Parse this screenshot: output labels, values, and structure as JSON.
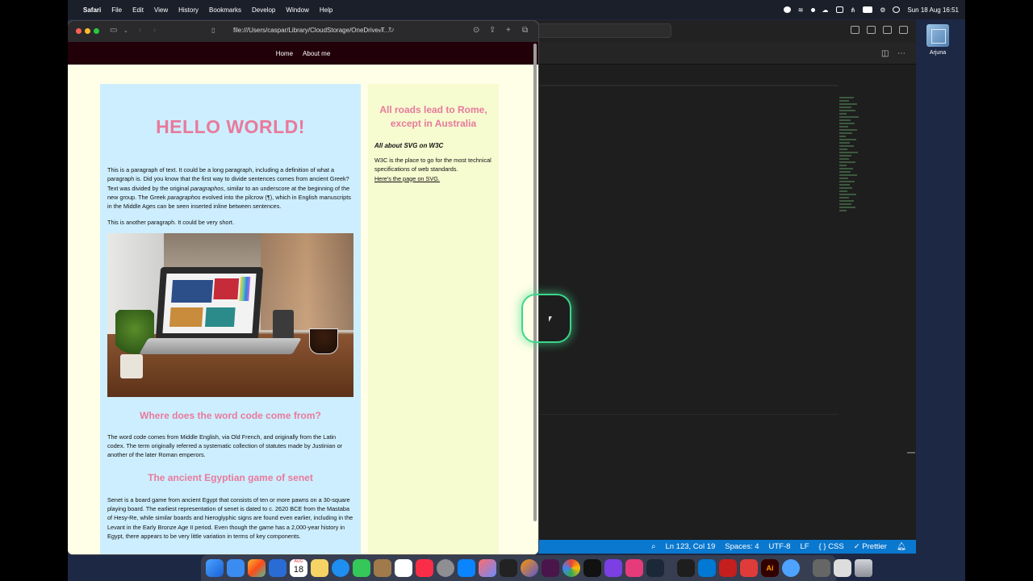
{
  "menubar": {
    "app_name": "Safari",
    "menus": [
      "File",
      "Edit",
      "View",
      "History",
      "Bookmarks",
      "Develop",
      "Window",
      "Help"
    ],
    "clock": "Sun 18 Aug  16:51"
  },
  "desktop_icon": {
    "label": "Arjuna"
  },
  "safari": {
    "url": "file:///Users/caspar/Library/CloudStorage/OneDrive-T..."
  },
  "page": {
    "nav": [
      "Home",
      "About me"
    ],
    "title": "HELLO WORLD!",
    "para1_a": "This is a paragraph of text. It could be a long paragraph, including a definition of what a paragraph is. Did you know that the first way to divide sentences comes from ancient Greek? Text was divided by the original ",
    "para1_em1": "paragraphos",
    "para1_b": ", similar to an underscore at the beginning of the new group. The Greek ",
    "para1_em2": "paragraphos",
    "para1_c": " evolved into the pilcrow (¶), which in English manuscripts in the Middle Ages can be seen inserted inline between sentences.",
    "para2": "This is another paragraph. It could be very short.",
    "h_code": "Where does the word code come from?",
    "p_code": "The word code comes from Middle English, via Old French, and originally from the Latin codex. The term originally referred a systematic collection of statutes made by Justinian or another of the later Roman emperors.",
    "h_senet": "The ancient Egyptian game of senet",
    "p_senet": "Senet is a board game from ancient Egypt that consists of ten or more pawns on a 30-square playing board. The earliest representation of senet is dated to c. 2620 BCE from the Mastaba of Hesy-Re, while similar boards and hieroglyphic signs are found even earlier, including in the Levant in the Early Bronze Age II period. Even though the game has a 2,000-year history in Egypt, there appears to be very little variation in terms of key components.",
    "aside_title": "All roads lead to Rome, except in Australia",
    "aside_sub": "All about SVG on W3C",
    "aside_text": "W3C is the place to go for the most technical specifications of web standards.",
    "aside_link": "Here's the page on SVG."
  },
  "editor_status": {
    "position": "Ln 123, Col 19",
    "spaces": "Spaces: 4",
    "encoding": "UTF-8",
    "eol": "LF",
    "language": "{ } CSS",
    "formatter": "✓ Prettier"
  },
  "dock": {
    "calendar_month": "AUG",
    "calendar_day": "18"
  },
  "colors": {
    "accent_pink": "#e87a9c",
    "main_bg": "#cdeefe",
    "aside_bg": "#f6fbd0",
    "page_bg": "#feffe6",
    "nav_bg": "#22000a",
    "status_blue": "#0a78cf",
    "cursor_ring": "#3dd68c"
  }
}
